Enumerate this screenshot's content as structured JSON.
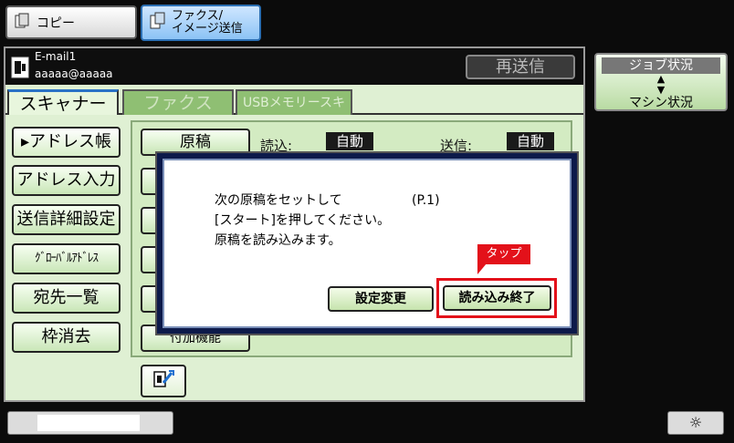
{
  "modes": {
    "copy_label": "コピー",
    "fax_line1": "ファクス/",
    "fax_line2": "イメージ送信"
  },
  "header": {
    "dest_type": "E-mail1",
    "dest_address": "aaaaa@aaaaa",
    "resend_label": "再送信"
  },
  "tabs": {
    "scanner": "スキャナー",
    "fax": "ファクス",
    "usb": "USBメモリースキャン"
  },
  "sidebar": {
    "address_book": "▸アドレス帳",
    "address_input": "アドレス入力",
    "send_detail": "送信詳細設定",
    "global_address": "ｸﾞﾛｰﾊﾞﾙｱﾄﾞﾚｽ",
    "dest_list": "宛先一覧",
    "erase_frame": "枠消去"
  },
  "settings": {
    "original_label": "原稿",
    "read_label": "読込:",
    "read_value": "自動",
    "send_label": "送信:",
    "send_value": "自動",
    "extra_label": "付加機能"
  },
  "right_panel": {
    "job_status": "ジョブ状況",
    "machine_status": "マシン状況"
  },
  "dialog": {
    "line1": "次の原稿をセットして",
    "page": "(P.1)",
    "line2": "[スタート]を押してください。",
    "line3": "原稿を読み込みます。",
    "change_settings_label": "設定変更",
    "read_end_label": "読み込み終了",
    "tap_label": "タップ"
  },
  "bottom": {
    "brightness_icon": "☼"
  },
  "colors": {
    "panel_bg": "#dff0d3",
    "accent_blue": "#2a72c6",
    "highlight_red": "#e3111a"
  }
}
